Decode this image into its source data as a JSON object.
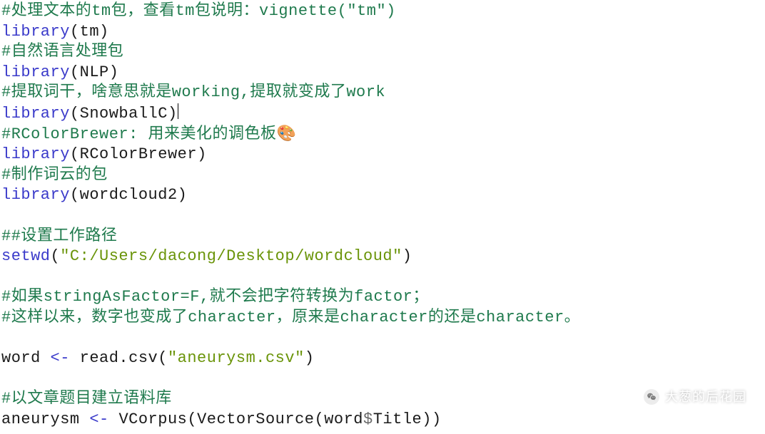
{
  "tokens": {
    "library": "library",
    "lp": "(",
    "rp": ")",
    "assign": "<-",
    "dollar": "$"
  },
  "lines": {
    "0": {
      "a": "#处理文本的tm包，查看tm包说明：",
      "b": "vignette(\"tm\")"
    },
    "1": {
      "arg": "tm"
    },
    "2": {
      "a": "#自然语言处理包"
    },
    "3": {
      "arg": "NLP"
    },
    "4": {
      "a": "#提取词干，啥意思就是working,提取就变成了work"
    },
    "5": {
      "arg": "SnowballC"
    },
    "6": {
      "a": "#RColorBrewer: 用来美化的调色板",
      "emoji": "🎨"
    },
    "7": {
      "arg": "RColorBrewer"
    },
    "8": {
      "a": "#制作词云的包"
    },
    "9": {
      "arg": "wordcloud2"
    },
    "11": {
      "a": "##设置工作路径"
    },
    "12": {
      "fn": "setwd",
      "str": "\"C:/Users/dacong/Desktop/wordcloud\""
    },
    "14": {
      "a": "#如果stringAsFactor=F,就不会把字符转换为factor；"
    },
    "15": {
      "a": "#这样以来，数字也变成了character，原来是character的还是character。"
    },
    "17": {
      "lhs": "word",
      "fn": "read.csv",
      "str": "\"aneurysm.csv\""
    },
    "19": {
      "a": "#以文章题目建立语料库"
    },
    "20": {
      "lhs": "aneurysm",
      "fn1": "VCorpus",
      "fn2": "VectorSource",
      "obj": "word",
      "col": "Title"
    }
  },
  "watermark": "大葱的后花园"
}
